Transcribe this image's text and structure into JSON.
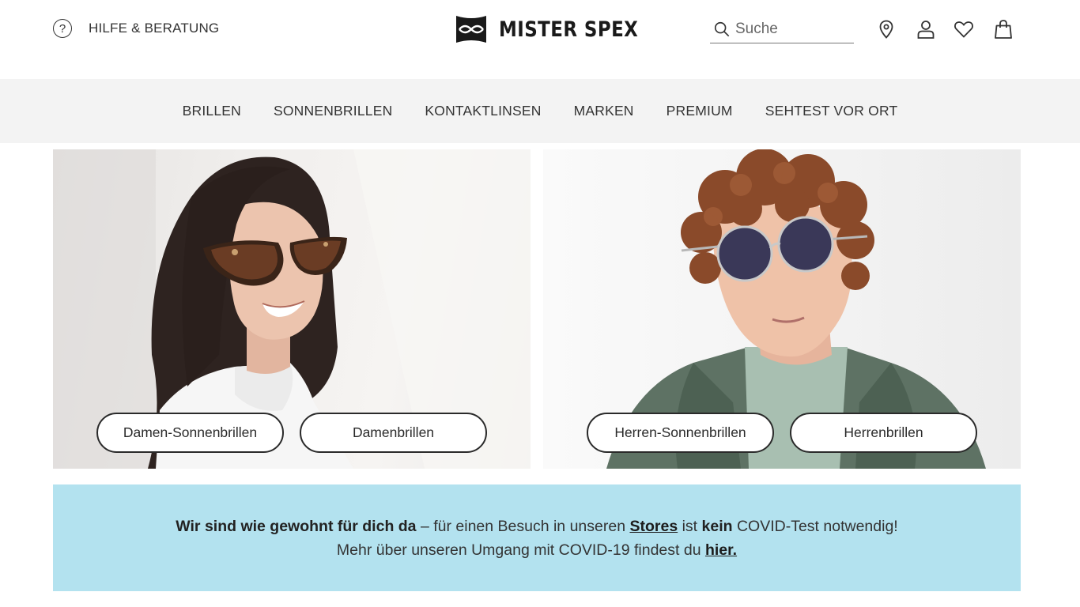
{
  "header": {
    "help_label": "HILFE & BERATUNG",
    "help_icon": "question-circle-icon",
    "brand": "MISTER SPEX",
    "search_placeholder": "Suche",
    "icons": [
      "location-pin-icon",
      "user-icon",
      "heart-icon",
      "shopping-bag-icon"
    ]
  },
  "nav": {
    "items": [
      "BRILLEN",
      "SONNENBRILLEN",
      "KONTAKTLINSEN",
      "MARKEN",
      "PREMIUM",
      "SEHTEST VOR ORT"
    ]
  },
  "hero": {
    "women": {
      "buttons": [
        "Damen-Sonnenbrillen",
        "Damenbrillen"
      ]
    },
    "men": {
      "buttons": [
        "Herren-Sonnenbrillen",
        "Herrenbrillen"
      ]
    }
  },
  "banner": {
    "line1_bold": "Wir sind wie gewohnt für dich da",
    "line1_text1": " – für einen Besuch in unseren ",
    "line1_link": "Stores",
    "line1_text2": " ist ",
    "line1_bold2": "kein",
    "line1_text3": " COVID-Test notwendig!",
    "line2_text": "Mehr über unseren Umgang mit COVID-19 findest du ",
    "line2_link": "hier.",
    "background": "#b3e2ef"
  }
}
